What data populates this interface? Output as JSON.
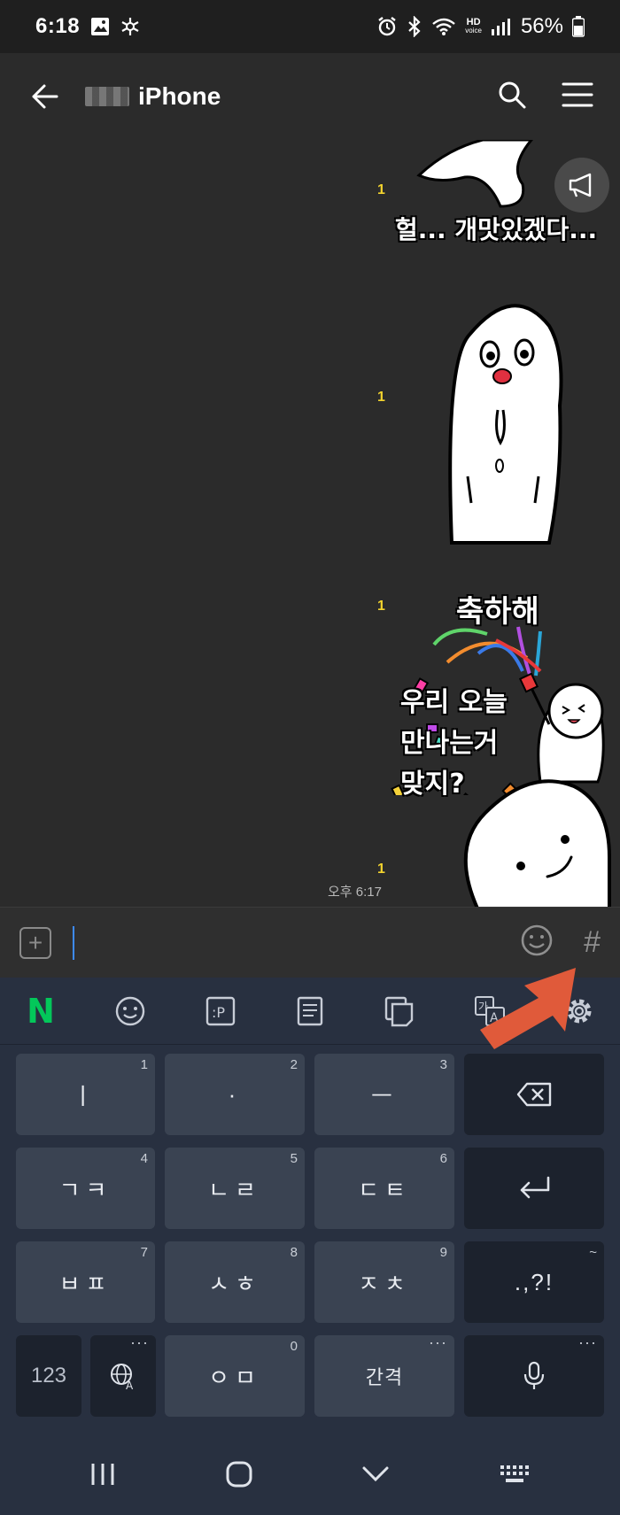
{
  "status_bar": {
    "time": "6:18",
    "battery": "56%",
    "icons": [
      "image-icon",
      "snowflake-icon",
      "alarm-icon",
      "bluetooth-icon",
      "wifi-icon",
      "hd-voice-icon",
      "signal-icon",
      "battery-icon"
    ]
  },
  "header": {
    "title": "iPhone",
    "icons": [
      "back-arrow-icon",
      "search-icon",
      "menu-icon"
    ]
  },
  "chat": {
    "read_counts": [
      "1",
      "1",
      "1",
      "1"
    ],
    "timestamp": "오후 6:17",
    "stickers": [
      {
        "caption": ""
      },
      {
        "caption": "헐... 개맛있겠다..."
      },
      {
        "caption": "축하해"
      },
      {
        "caption_lines": [
          "우리 오늘",
          "만나는거",
          "맞지?"
        ]
      }
    ],
    "announcement_icon": "megaphone-icon"
  },
  "input_bar": {
    "plus": "+",
    "hash": "#"
  },
  "keyboard": {
    "toolbar": [
      "N",
      "smile-icon",
      "p-sticker-icon",
      "memo-icon",
      "clipboard-icon",
      "translate-icon",
      "settings-icon"
    ],
    "rows": [
      [
        {
          "label": "ㅣ",
          "num": "1"
        },
        {
          "label": "·",
          "num": "2"
        },
        {
          "label": "ㅡ",
          "num": "3"
        },
        {
          "label": "⌫",
          "num": ""
        }
      ],
      [
        {
          "label": "ㄱㅋ",
          "num": "4"
        },
        {
          "label": "ㄴㄹ",
          "num": "5"
        },
        {
          "label": "ㄷㅌ",
          "num": "6"
        },
        {
          "label": "↵",
          "num": ""
        }
      ],
      [
        {
          "label": "ㅂㅍ",
          "num": "7"
        },
        {
          "label": "ㅅㅎ",
          "num": "8"
        },
        {
          "label": "ㅈㅊ",
          "num": "9"
        },
        {
          "label": ".,?!",
          "num": "~"
        }
      ],
      [
        {
          "label": "123",
          "num": ""
        },
        {
          "label": "🌐",
          "num": "···"
        },
        {
          "label": "ㅇㅁ",
          "num": "0"
        },
        {
          "label": "간격",
          "num": "···"
        },
        {
          "label": "🎤",
          "num": "···"
        }
      ]
    ]
  },
  "nav": {
    "icons": [
      "recents-icon",
      "home-icon",
      "back-down-icon",
      "keyboard-switch-icon"
    ]
  },
  "colors": {
    "bg": "#2b2b2b",
    "keyboard": "#283040",
    "key": "#3a4352",
    "read": "#f2d32e",
    "accent_arrow": "#e05a3a",
    "naver": "#03c75a"
  }
}
